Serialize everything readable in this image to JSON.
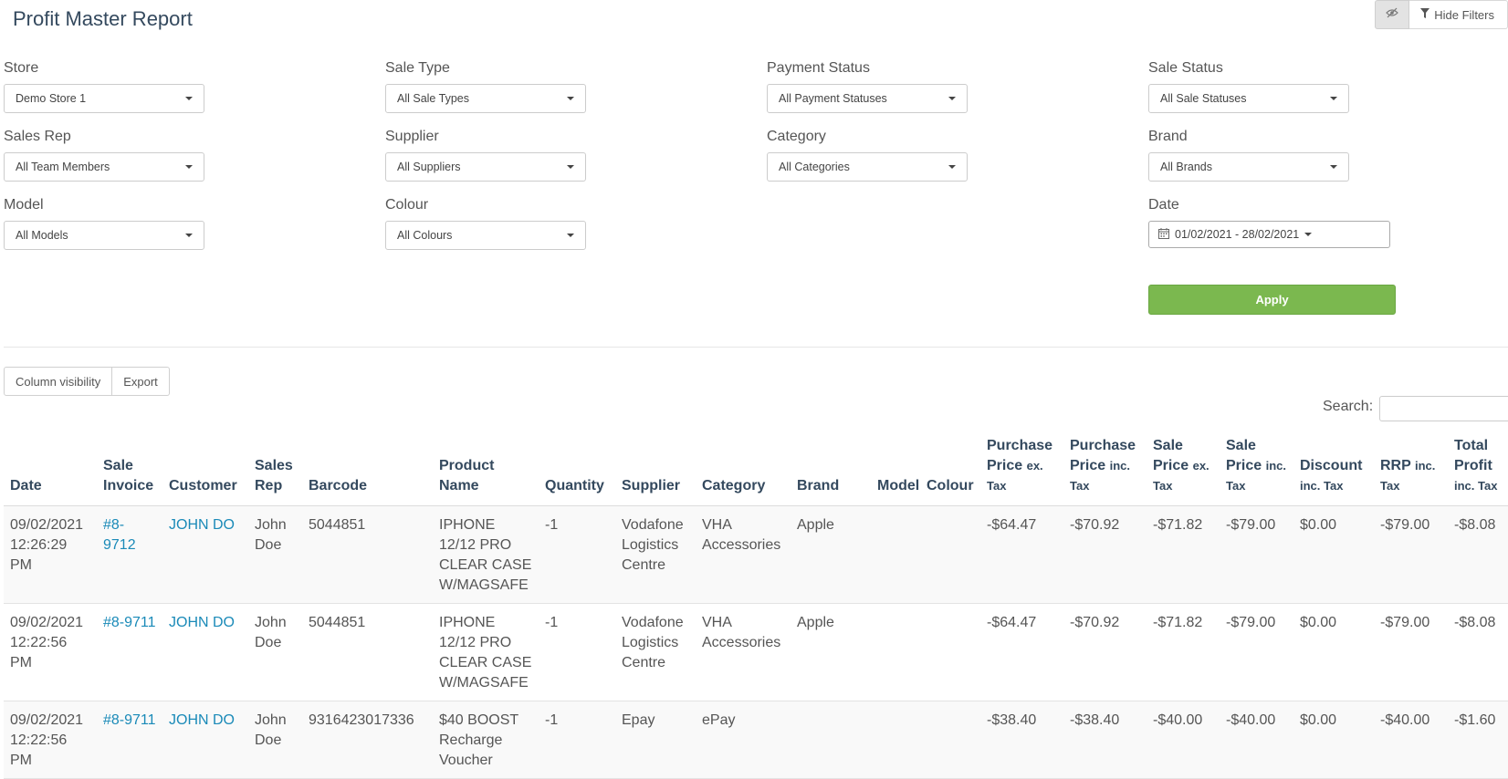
{
  "page": {
    "title": "Profit Master Report",
    "hide_filters_label": "Hide Filters",
    "eye_icon": "eye-slash-icon",
    "filter_icon": "filter-icon"
  },
  "filters": {
    "store": {
      "label": "Store",
      "value": "Demo Store 1"
    },
    "sale_type": {
      "label": "Sale Type",
      "value": "All Sale Types"
    },
    "payment_status": {
      "label": "Payment Status",
      "value": "All Payment Statuses"
    },
    "sale_status": {
      "label": "Sale Status",
      "value": "All Sale Statuses"
    },
    "sales_rep": {
      "label": "Sales Rep",
      "value": "All Team Members"
    },
    "supplier": {
      "label": "Supplier",
      "value": "All Suppliers"
    },
    "category": {
      "label": "Category",
      "value": "All Categories"
    },
    "brand": {
      "label": "Brand",
      "value": "All Brands"
    },
    "model": {
      "label": "Model",
      "value": "All Models"
    },
    "colour": {
      "label": "Colour",
      "value": "All Colours"
    },
    "date": {
      "label": "Date",
      "value": "01/02/2021 - 28/02/2021"
    },
    "apply_label": "Apply"
  },
  "toolbar": {
    "column_visibility": "Column visibility",
    "export": "Export",
    "search_label": "Search:",
    "search_value": ""
  },
  "colors": {
    "accent_green": "#7bb84f",
    "link_blue": "#1a8ab8",
    "heading": "#34495e"
  },
  "table": {
    "headers": {
      "date": "Date",
      "sale_invoice": "Sale Invoice",
      "customer": "Customer",
      "sales_rep": "Sales Rep",
      "barcode": "Barcode",
      "product_name": "Product Name",
      "quantity": "Quantity",
      "supplier": "Supplier",
      "category": "Category",
      "brand": "Brand",
      "model": "Model",
      "colour": "Colour",
      "purchase_ex": {
        "main": "Purchase Price",
        "suffix": "ex. Tax"
      },
      "purchase_inc": {
        "main": "Purchase Price",
        "suffix": "inc. Tax"
      },
      "sale_ex": {
        "main": "Sale Price",
        "suffix": "ex. Tax"
      },
      "sale_inc": {
        "main": "Sale Price",
        "suffix": "inc. Tax"
      },
      "discount": {
        "main": "Discount",
        "suffix": "inc. Tax"
      },
      "rrp": {
        "main": "RRP",
        "suffix": "inc. Tax"
      },
      "total_profit": {
        "main": "Total Profit",
        "suffix": "inc. Tax"
      }
    },
    "rows": [
      {
        "date": "09/02/2021 12:26:29 PM",
        "invoice": "#8-9712",
        "customer": "JOHN DO",
        "sales_rep": "John Doe",
        "barcode": "5044851",
        "product": "IPHONE 12/12 PRO CLEAR CASE W/MAGSAFE",
        "quantity": "-1",
        "supplier": "Vodafone Logistics Centre",
        "category": "VHA Accessories",
        "brand": "Apple",
        "model": "",
        "colour": "",
        "purchase_ex": "-$64.47",
        "purchase_inc": "-$70.92",
        "sale_ex": "-$71.82",
        "sale_inc": "-$79.00",
        "discount": "$0.00",
        "rrp": "-$79.00",
        "total_profit": "-$8.08"
      },
      {
        "date": "09/02/2021 12:22:56 PM",
        "invoice": "#8-9711",
        "customer": "JOHN DO",
        "sales_rep": "John Doe",
        "barcode": "5044851",
        "product": "IPHONE 12/12 PRO CLEAR CASE W/MAGSAFE",
        "quantity": "-1",
        "supplier": "Vodafone Logistics Centre",
        "category": "VHA Accessories",
        "brand": "Apple",
        "model": "",
        "colour": "",
        "purchase_ex": "-$64.47",
        "purchase_inc": "-$70.92",
        "sale_ex": "-$71.82",
        "sale_inc": "-$79.00",
        "discount": "$0.00",
        "rrp": "-$79.00",
        "total_profit": "-$8.08"
      },
      {
        "date": "09/02/2021 12:22:56 PM",
        "invoice": "#8-9711",
        "customer": "JOHN DO",
        "sales_rep": "John Doe",
        "barcode": "9316423017336",
        "product": "$40 BOOST Recharge Voucher",
        "quantity": "-1",
        "supplier": "Epay",
        "category": "ePay",
        "brand": "",
        "model": "",
        "colour": "",
        "purchase_ex": "-$38.40",
        "purchase_inc": "-$38.40",
        "sale_ex": "-$40.00",
        "sale_inc": "-$40.00",
        "discount": "$0.00",
        "rrp": "-$40.00",
        "total_profit": "-$1.60"
      }
    ]
  }
}
